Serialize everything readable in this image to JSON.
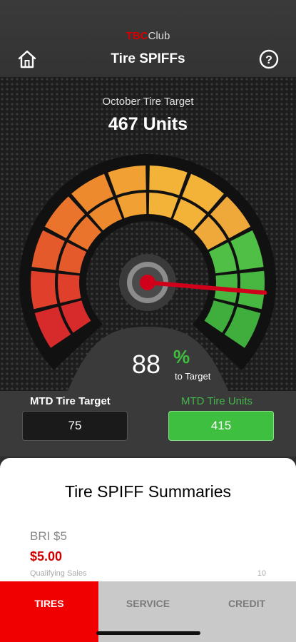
{
  "header": {
    "brand_prefix": "TBC",
    "brand_suffix": "Club",
    "title": "Tire SPIFFs",
    "home_icon": "home-icon",
    "help_icon": "help-circle-icon"
  },
  "gauge": {
    "target_label": "October Tire Target",
    "target_value": "467 Units",
    "percent_value": "88",
    "percent_sign": "%",
    "percent_caption": "to Target",
    "needle_fraction": 0.88
  },
  "mtd": {
    "target_label": "MTD Tire Target",
    "target_value": "75",
    "units_label": "MTD Tire Units",
    "units_value": "415"
  },
  "summary": {
    "title": "Tire SPIFF Summaries",
    "item_name": "BRI $5",
    "item_amount": "$5.00",
    "qualifying_label": "Qualifying Sales",
    "qualifying_value": "10"
  },
  "tabs": [
    {
      "label": "TIRES",
      "active": true
    },
    {
      "label": "SERVICE",
      "active": false
    },
    {
      "label": "CREDIT",
      "active": false
    }
  ],
  "colors": {
    "accent_red": "#f00000",
    "accent_green": "#3fbf3f"
  }
}
